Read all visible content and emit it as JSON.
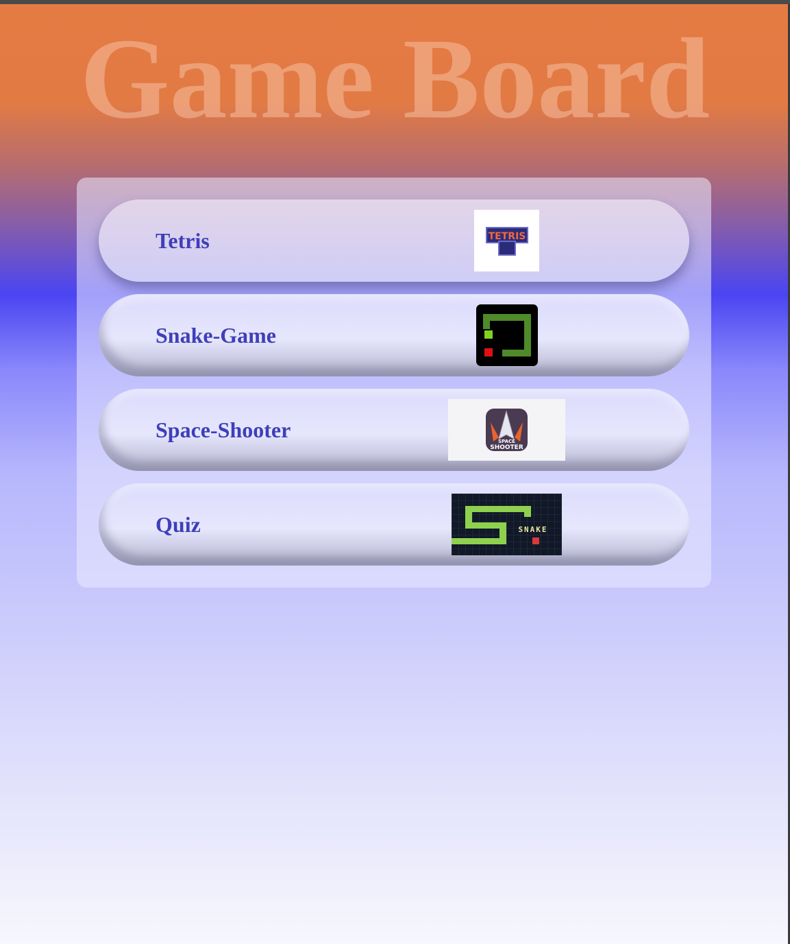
{
  "page": {
    "title": "Game Board"
  },
  "games": [
    {
      "label": "Tetris",
      "thumbnail_icon": "tetris-logo-icon",
      "thumbnail_text": "TETRIS"
    },
    {
      "label": "Snake-Game",
      "thumbnail_icon": "snake-game-icon"
    },
    {
      "label": "Space-Shooter",
      "thumbnail_icon": "space-shooter-icon",
      "thumbnail_text_line1": "SPACE",
      "thumbnail_text_line2": "SHOOTER"
    },
    {
      "label": "Quiz",
      "thumbnail_icon": "snake-banner-icon",
      "thumbnail_text": "SNAKE"
    }
  ],
  "colors": {
    "title_text": "#f6bea0",
    "label_text": "#3f3fb9",
    "bg_top": "#e57b43",
    "bg_mid": "#4a45f2",
    "bg_bottom": "#f7f7fd"
  }
}
